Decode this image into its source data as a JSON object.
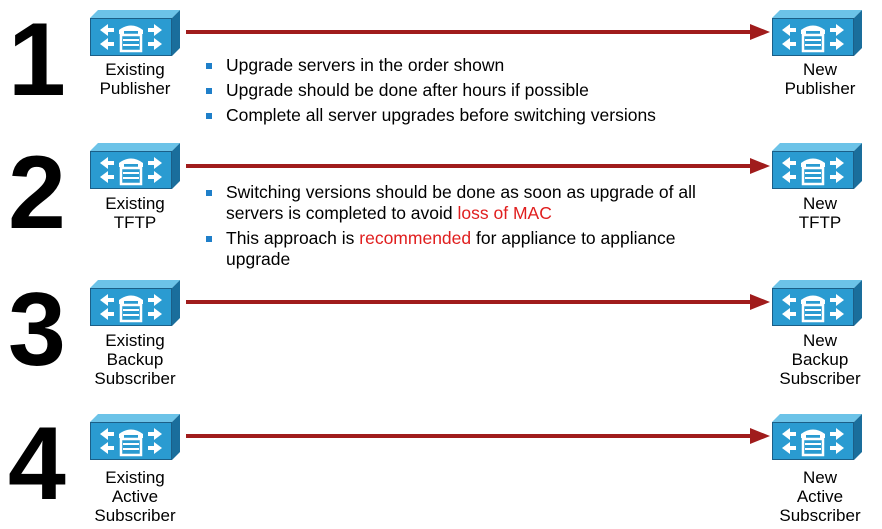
{
  "colors": {
    "arrow": "#a01c1c",
    "icon_face": "#2a9bd1",
    "icon_side": "#1a6e9c",
    "icon_top": "#6cc3e8",
    "bullet": "#1f7fc9",
    "highlight": "#e01e1e"
  },
  "icon_semantic": "call-manager-server-icon",
  "steps": [
    {
      "number": "1",
      "existing": [
        "Existing",
        "Publisher"
      ],
      "new": [
        "New",
        "Publisher"
      ]
    },
    {
      "number": "2",
      "existing": [
        "Existing",
        "TFTP"
      ],
      "new": [
        "New",
        "TFTP"
      ]
    },
    {
      "number": "3",
      "existing": [
        "Existing",
        "Backup",
        "Subscriber"
      ],
      "new": [
        "New",
        "Backup",
        "Subscriber"
      ]
    },
    {
      "number": "4",
      "existing": [
        "Existing",
        "Active",
        "Subscriber"
      ],
      "new": [
        "New",
        "Active",
        "Subscriber"
      ]
    }
  ],
  "notes_group_1": [
    "Upgrade servers in the order shown",
    "Upgrade should be done after hours if possible",
    "Complete all server upgrades before switching versions"
  ],
  "notes_group_2": [
    {
      "before": "Switching versions should be done as soon as upgrade of all servers is completed to avoid ",
      "highlight": "loss of MAC",
      "after": ""
    },
    {
      "before": "This approach is ",
      "highlight": "recommended",
      "after": " for appliance to appliance upgrade"
    }
  ]
}
